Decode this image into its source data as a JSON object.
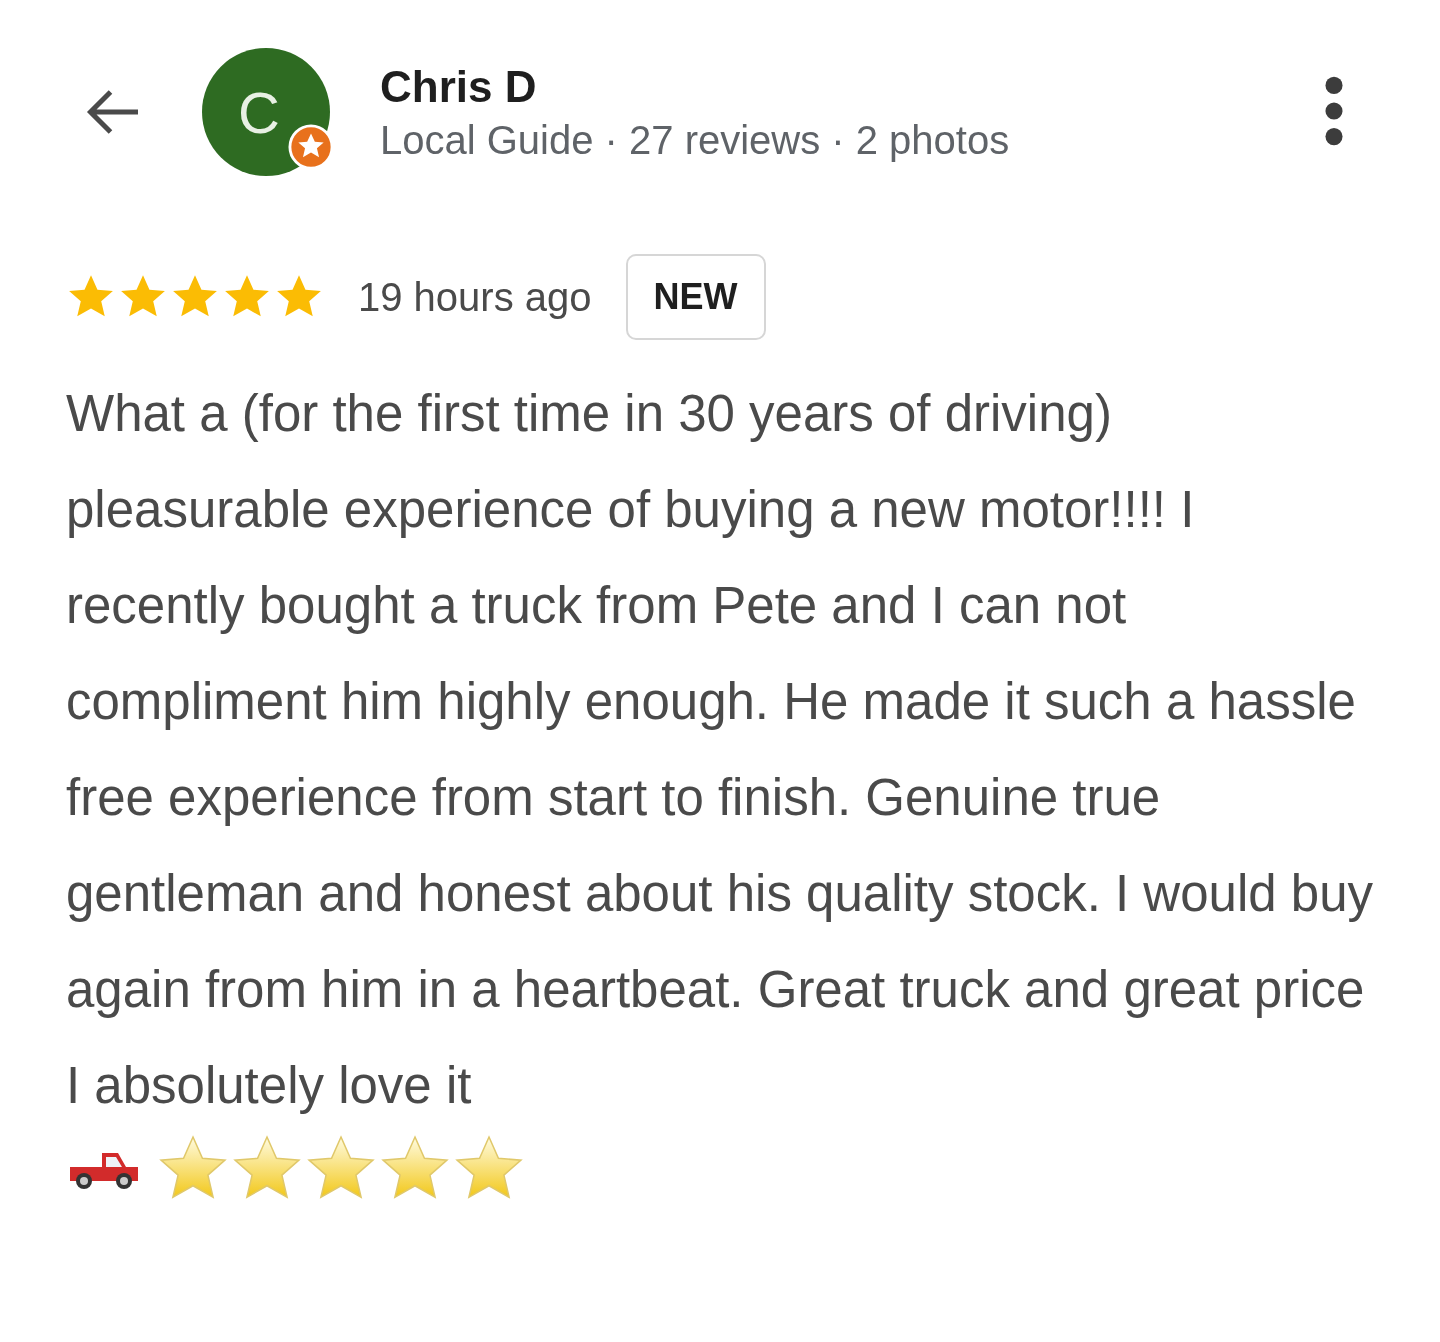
{
  "reviewer": {
    "avatar_letter": "C",
    "name": "Chris D",
    "meta": "Local Guide · 27 reviews · 2 photos",
    "local_guide": true
  },
  "review": {
    "stars": 5,
    "time": "19 hours ago",
    "badge": "NEW",
    "text": "What a (for the first time in 30 years of driving) pleasurable experience of buying a new motor!!!! I recently bought a truck from Pete and I can not compliment him highly enough. He made it such a hassle free experience from start to finish. Genuine true gentleman and honest about his quality stock. I would buy again from him in a heartbeat. Great truck and great price I absolutely love it",
    "emoji_rating": {
      "stars": 5
    }
  }
}
